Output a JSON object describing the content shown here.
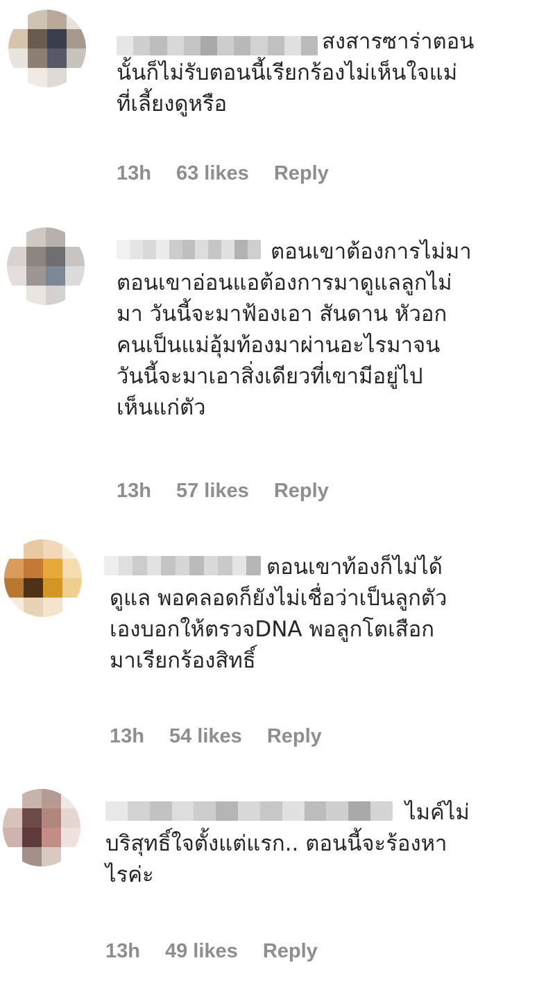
{
  "comments": [
    {
      "username_hidden": true,
      "lines": [
        "สงสารซาร่าตอน",
        "นั้นก็ไม่รับตอนนี้เรียกร้องไม่เห็นใจแม่",
        "ที่เลี้ยงดูหรือ"
      ],
      "time": "13h",
      "likes": "63 likes",
      "reply": "Reply",
      "avatar_colors": [
        "#ffffff",
        "#cfc3b3",
        "#b8a99a",
        "#e8e2da",
        "#d6c4ad",
        "#6b5a4e",
        "#3a3f4d",
        "#a79a8c",
        "#e9e4dd",
        "#8d7f73",
        "#565a66",
        "#c9c3bd",
        "#ffffff",
        "#efeae4",
        "#dedad6",
        "#ffffff"
      ],
      "blur_colors": [
        "#e6e6e6",
        "#cfcfcf",
        "#bdbdbd",
        "#d8d8d8",
        "#c4c4c4",
        "#a9a9a9",
        "#cdcdcd",
        "#b9b9b9",
        "#d2d2d2",
        "#c0c0c0",
        "#e0e0e0",
        "#bababa"
      ]
    },
    {
      "username_hidden": true,
      "lines": [
        "ตอนเขาต้องการไม่มา",
        "ตอนเขาอ่อนแอต้องการมาดูแลลูกไม่",
        "มา วันนี้จะมาฟ้องเอา สันดาน หัวอก",
        "คนเป็นแม่อุ้มท้องมาผ่านอะไรมาจน",
        "วันนี้จะมาเอาสิ่งเดียวที่เขามีอยู่ไป",
        "เห็นแก่ตัว"
      ],
      "time": "13h",
      "likes": "57 likes",
      "reply": "Reply",
      "avatar_colors": [
        "#ffffff",
        "#cfc8c3",
        "#b8b0ab",
        "#ffffff",
        "#d9d3cf",
        "#8f8580",
        "#6f6e73",
        "#c8c4c2",
        "#e3dfdc",
        "#9d9693",
        "#7e8796",
        "#dcdadb",
        "#ffffff",
        "#e8e5e3",
        "#d5d1cf",
        "#ffffff"
      ],
      "blur_colors": [
        "#f2f2f2",
        "#e5e5e5",
        "#d9d9d9",
        "#ececec",
        "#cccccc",
        "#bfbfbf",
        "#dddddd",
        "#c6c6c6",
        "#e1e1e1",
        "#b3b3b3",
        "#cfcfcf"
      ]
    },
    {
      "username_hidden": true,
      "lines": [
        "ตอนเขาท้องก็ไม่ได้",
        "ดูแล พอคลอดก็ยังไม่เชื่อว่าเป็นลูกตัว",
        "เองบอกให้ตรวจDNA พอลูกโตเสือก",
        "มาเรียกร้องสิทธิ์"
      ],
      "time": "13h",
      "likes": "54 likes",
      "reply": "Reply",
      "avatar_colors": [
        "#ffffff",
        "#e9c9a0",
        "#f0d8b8",
        "#fbf1e3",
        "#d99c5c",
        "#c47a35",
        "#e8a93b",
        "#f4dcae",
        "#b7782f",
        "#4e3217",
        "#d59522",
        "#efcf8e",
        "#f7ecde",
        "#e8d3b6",
        "#f2e4cd",
        "#ffffff"
      ],
      "blur_colors": [
        "#eeeeee",
        "#dfdfdf",
        "#cccccc",
        "#e2e2e2",
        "#c4c4c4",
        "#d6d6d6",
        "#bbbbbb",
        "#dadada",
        "#c9c9c9",
        "#e5e5e5",
        "#b6b6b6"
      ]
    },
    {
      "username_hidden": true,
      "lines": [
        "ไมค์ไม่",
        "บริสุทธิ์ใจตั้งแต่แรก.. ตอนนี้จะร้องหา",
        "ไรค่ะ"
      ],
      "time": "13h",
      "likes": "49 likes",
      "reply": "Reply",
      "avatar_colors": [
        "#ffffff",
        "#c9b4ad",
        "#b59b94",
        "#f1e8e5",
        "#d8c2bb",
        "#6e4a48",
        "#b2867c",
        "#e6d6d0",
        "#cdb3ac",
        "#5f3a3d",
        "#c38c84",
        "#f0e1dc",
        "#ffffff",
        "#a48f8b",
        "#d9c7c2",
        "#ffffff"
      ],
      "blur_colors": [
        "#e8e8e8",
        "#d3d3d3",
        "#c2c2c2",
        "#dddddd",
        "#cccccc",
        "#b5b5b5",
        "#d8d8d8",
        "#c7c7c7",
        "#e1e1e1",
        "#bcbcbc",
        "#cfcfcf",
        "#a9a9a9",
        "#d4d4d4"
      ]
    }
  ]
}
